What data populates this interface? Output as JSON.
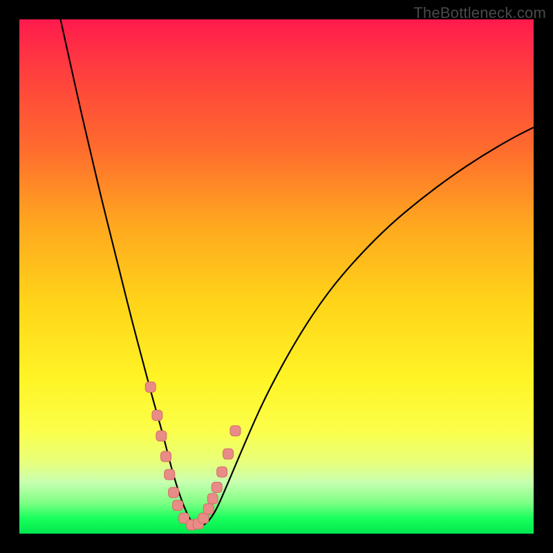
{
  "watermark": "TheBottleneck.com",
  "colors": {
    "curve_stroke": "#000000",
    "marker_fill": "#e98b86",
    "marker_stroke": "#d26e68",
    "frame_bg": "#000000"
  },
  "chart_data": {
    "type": "line",
    "title": "",
    "xlabel": "",
    "ylabel": "",
    "xlim": [
      0,
      100
    ],
    "ylim": [
      0,
      100
    ],
    "series": [
      {
        "name": "bottleneck-curve",
        "x": [
          8,
          10,
          12,
          14,
          16,
          18,
          20,
          22,
          24,
          26,
          28,
          29.5,
          31,
          32.5,
          34,
          36,
          38,
          40,
          44,
          48,
          54,
          60,
          66,
          72,
          78,
          84,
          90,
          96,
          100
        ],
        "y": [
          100,
          91,
          82,
          73.5,
          65,
          57,
          49,
          41,
          33.5,
          26,
          19,
          13,
          8,
          4,
          1.5,
          1.5,
          4,
          8.5,
          18,
          27,
          38,
          47,
          54,
          60,
          65,
          69.5,
          73.5,
          77,
          79
        ]
      }
    ],
    "markers": {
      "name": "highlight-points",
      "x": [
        25.5,
        26.8,
        27.6,
        28.5,
        29.2,
        30.0,
        30.8,
        32.0,
        33.5,
        34.8,
        35.8,
        36.8,
        37.6,
        38.4,
        39.4,
        40.6,
        42.0
      ],
      "y": [
        28.5,
        23.0,
        19.0,
        15.0,
        11.5,
        8.0,
        5.5,
        3.0,
        1.7,
        1.9,
        3.0,
        4.8,
        6.8,
        9.0,
        12.0,
        15.5,
        20.0
      ]
    }
  }
}
